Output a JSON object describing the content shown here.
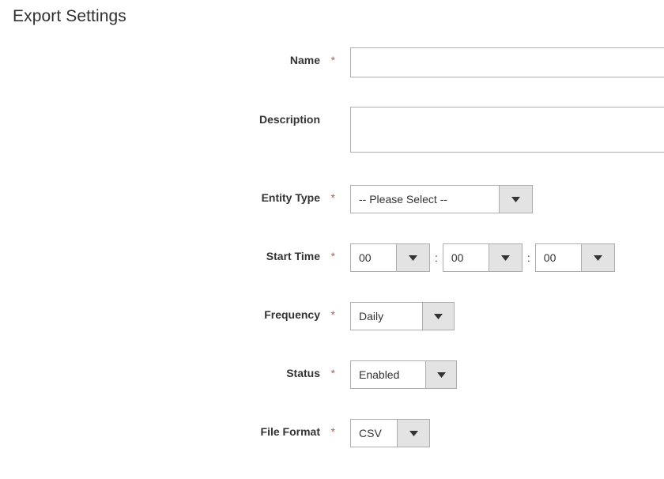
{
  "page": {
    "title": "Export Settings"
  },
  "colors": {
    "required_asterisk": "#c7584f",
    "label_text": "#333333",
    "title_text": "#303030",
    "input_border": "#adadad",
    "select_button_bg": "#e3e3e3",
    "page_background": "#ffffff"
  },
  "form": {
    "required_mark": "*",
    "time_separator": ":",
    "fields": {
      "name": {
        "label": "Name",
        "value": "",
        "placeholder": ""
      },
      "description": {
        "label": "Description",
        "value": "",
        "placeholder": ""
      },
      "entity_type": {
        "label": "Entity Type",
        "selected": "-- Please Select --"
      },
      "start_time": {
        "label": "Start Time",
        "hours": "00",
        "minutes": "00",
        "seconds": "00"
      },
      "frequency": {
        "label": "Frequency",
        "selected": "Daily"
      },
      "status": {
        "label": "Status",
        "selected": "Enabled"
      },
      "file_format": {
        "label": "File Format",
        "selected": "CSV"
      }
    }
  },
  "icons": {
    "dropdown_arrow": "chevron-down-icon"
  }
}
